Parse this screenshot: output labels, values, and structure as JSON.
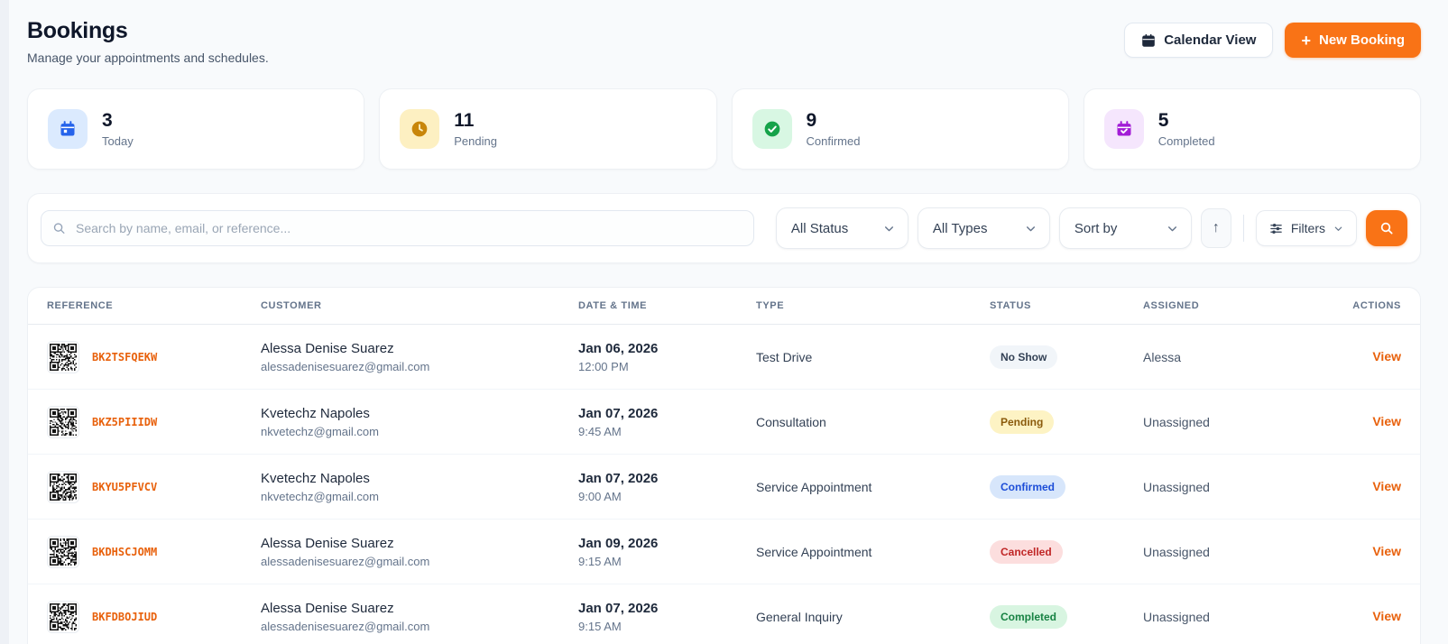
{
  "page": {
    "title": "Bookings",
    "subtitle": "Manage your appointments and schedules."
  },
  "header": {
    "calendar_view_label": "Calendar View",
    "new_booking_label": "New Booking",
    "plus_glyph": "+"
  },
  "stats": [
    {
      "value": "3",
      "label": "Today",
      "icon": "calendar-icon",
      "icon_style": "background:#dbeafe"
    },
    {
      "value": "11",
      "label": "Pending",
      "icon": "clock-icon",
      "icon_style": "background:#fdf0c2"
    },
    {
      "value": "9",
      "label": "Confirmed",
      "icon": "check-circle-icon",
      "icon_style": "background:#d8f7e3"
    },
    {
      "value": "5",
      "label": "Completed",
      "icon": "calendar-check-icon",
      "icon_style": "background:#f5e6fd"
    }
  ],
  "filters": {
    "search_placeholder": "Search by name, email, or reference...",
    "status_dropdown": "All Status",
    "types_dropdown": "All Types",
    "sort_dropdown": "Sort by",
    "sort_direction_glyph": "↑",
    "filters_label": "Filters"
  },
  "table": {
    "columns": [
      "REFERENCE",
      "CUSTOMER",
      "DATE & TIME",
      "TYPE",
      "STATUS",
      "ASSIGNED",
      "ACTIONS"
    ],
    "rows": [
      {
        "reference": "BK2TSFQEKW",
        "customer": "Alessa Denise Suarez",
        "email": "alessadenisesuarez@gmail.com",
        "date": "Jan 06, 2026",
        "time": "12:00 PM",
        "type": "Test Drive",
        "status": "No Show",
        "status_style": "background:#f1f5f9;color:#334155",
        "assigned": "Alessa",
        "action": "View"
      },
      {
        "reference": "BKZ5PIIIDW",
        "customer": "Kvetechz Napoles",
        "email": "nkvetechz@gmail.com",
        "date": "Jan 07, 2026",
        "time": "9:45 AM",
        "type": "Consultation",
        "status": "Pending",
        "status_style": "background:#fdf3c4;color:#8a5a0b",
        "assigned": "Unassigned",
        "action": "View"
      },
      {
        "reference": "BKYU5PFVCV",
        "customer": "Kvetechz Napoles",
        "email": "nkvetechz@gmail.com",
        "date": "Jan 07, 2026",
        "time": "9:00 AM",
        "type": "Service Appointment",
        "status": "Confirmed",
        "status_style": "background:#d7e6fb;color:#1d4ed8",
        "assigned": "Unassigned",
        "action": "View"
      },
      {
        "reference": "BKDHSCJOMM",
        "customer": "Alessa Denise Suarez",
        "email": "alessadenisesuarez@gmail.com",
        "date": "Jan 09, 2026",
        "time": "9:15 AM",
        "type": "Service Appointment",
        "status": "Cancelled",
        "status_style": "background:#fcdede;color:#c02626",
        "assigned": "Unassigned",
        "action": "View"
      },
      {
        "reference": "BKFDBOJIUD",
        "customer": "Alessa Denise Suarez",
        "email": "alessadenisesuarez@gmail.com",
        "date": "Jan 07, 2026",
        "time": "9:15 AM",
        "type": "General Inquiry",
        "status": "Completed",
        "status_style": "background:#d8f5e1;color:#178243",
        "assigned": "Unassigned",
        "action": "View"
      }
    ]
  },
  "colors": {
    "accent_orange": "#f97316",
    "reference_orange": "#e8610c",
    "page_background": "#f8fafc"
  }
}
